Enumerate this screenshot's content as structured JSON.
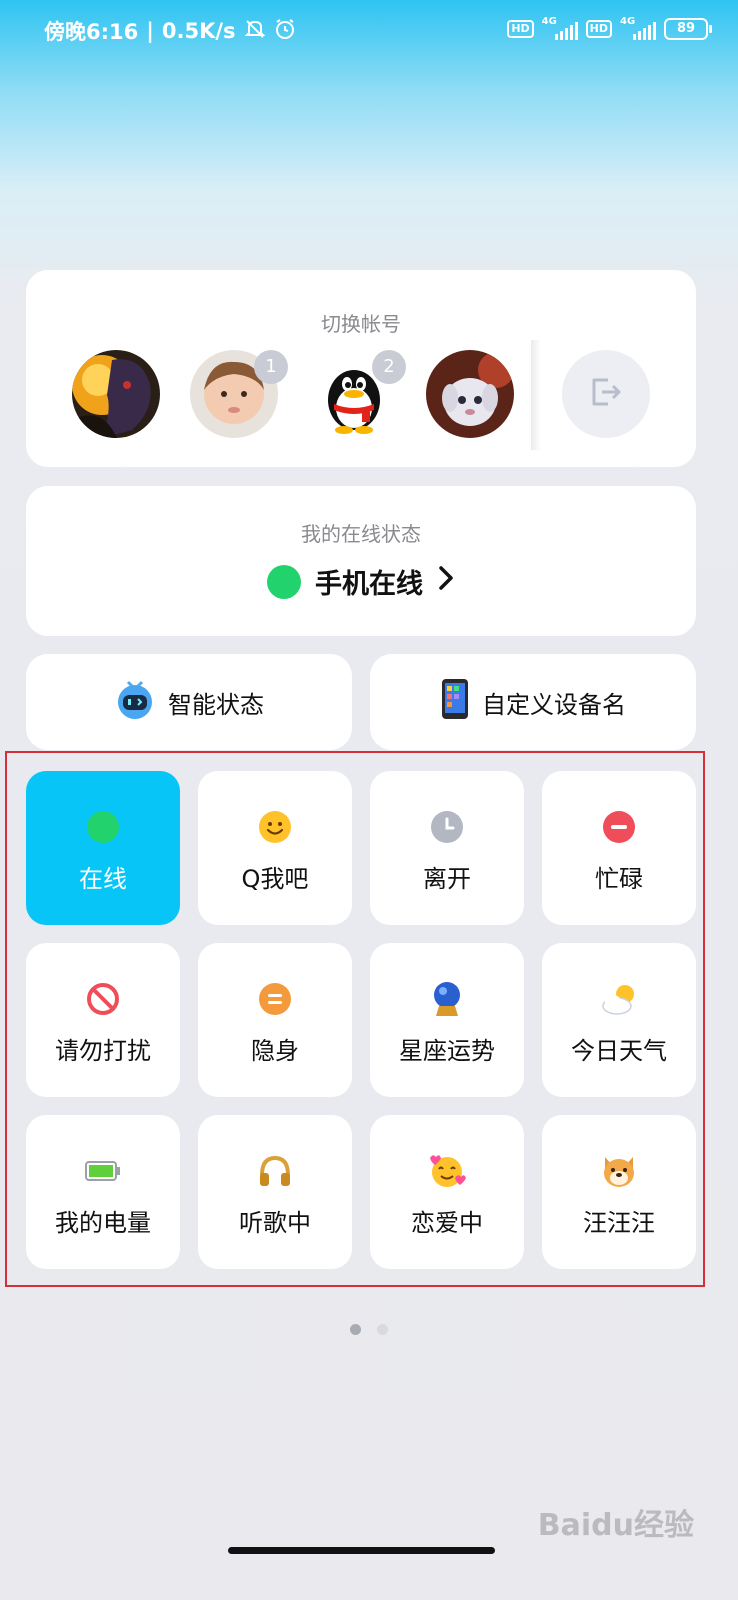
{
  "statusbar": {
    "time": "傍晚6:16",
    "speed": "0.5K/s",
    "hd1": "HD",
    "net1": "4G",
    "hd2": "HD",
    "net2": "4G",
    "battery": "89"
  },
  "switch_account": {
    "title": "切换帐号",
    "badges": [
      "1",
      "2"
    ]
  },
  "online_status": {
    "title": "我的在线状态",
    "value": "手机在线"
  },
  "shortcuts": {
    "smart_status": "智能状态",
    "custom_device": "自定义设备名"
  },
  "status_grid": [
    {
      "label": "在线",
      "icon": "green-dot-icon"
    },
    {
      "label": "Q我吧",
      "icon": "smiley-icon"
    },
    {
      "label": "离开",
      "icon": "clock-icon"
    },
    {
      "label": "忙碌",
      "icon": "busy-minus-icon"
    },
    {
      "label": "请勿打扰",
      "icon": "no-entry-icon"
    },
    {
      "label": "隐身",
      "icon": "invisible-icon"
    },
    {
      "label": "星座运势",
      "icon": "crystal-ball-icon"
    },
    {
      "label": "今日天气",
      "icon": "weather-icon"
    },
    {
      "label": "我的电量",
      "icon": "battery-icon"
    },
    {
      "label": "听歌中",
      "icon": "headphones-icon"
    },
    {
      "label": "恋爱中",
      "icon": "love-face-icon"
    },
    {
      "label": "汪汪汪",
      "icon": "dog-icon"
    }
  ],
  "pager": {
    "pages": 2,
    "current": 1
  },
  "watermark": "Baidu经验",
  "colors": {
    "active_tile": "#07c5f7",
    "online_green": "#22d36d",
    "highlight_frame": "#d3303a"
  }
}
